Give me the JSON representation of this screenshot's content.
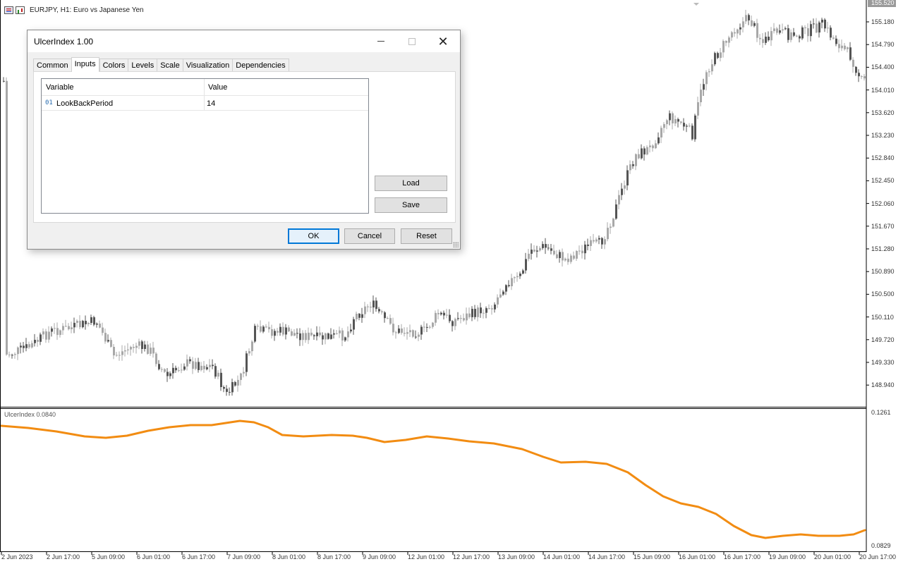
{
  "chart": {
    "symbol_title": "EURJPY, H1:  Euro vs Japanese Yen",
    "current_price": "155.520",
    "price_axis": [
      "155.180",
      "154.790",
      "154.400",
      "154.010",
      "153.620",
      "153.230",
      "152.840",
      "152.450",
      "152.060",
      "151.670",
      "151.280",
      "150.890",
      "150.500",
      "150.110",
      "149.720",
      "149.330",
      "148.940"
    ],
    "time_axis": [
      "2 Jun 2023",
      "2 Jun 17:00",
      "5 Jun 09:00",
      "6 Jun 01:00",
      "6 Jun 17:00",
      "7 Jun 09:00",
      "8 Jun 01:00",
      "8 Jun 17:00",
      "9 Jun 09:00",
      "12 Jun 01:00",
      "12 Jun 17:00",
      "13 Jun 09:00",
      "14 Jun 01:00",
      "14 Jun 17:00",
      "15 Jun 09:00",
      "16 Jun 01:00",
      "16 Jun 17:00",
      "19 Jun 09:00",
      "20 Jun 01:00",
      "20 Jun 17:00"
    ],
    "indicator_label": "UlcerIndex 0.0840",
    "indicator_axis_top": "0.1261",
    "indicator_axis_bottom": "0.0829",
    "colors": {
      "candle": "#a8a8a8",
      "candle_dark": "#555555",
      "indicator_line": "#f28c12",
      "axis_line": "#000000"
    },
    "icons": [
      "chart-window-icon",
      "chart-type-icon"
    ]
  },
  "dialog": {
    "title": "UlcerIndex 1.00",
    "tabs": [
      "Common",
      "Inputs",
      "Colors",
      "Levels",
      "Scale",
      "Visualization",
      "Dependencies"
    ],
    "active_tab": "Inputs",
    "grid": {
      "col_variable": "Variable",
      "col_value": "Value",
      "rows": [
        {
          "icon": "01",
          "variable": "LookBackPeriod",
          "value": "14"
        }
      ]
    },
    "buttons": {
      "load": "Load",
      "save": "Save",
      "ok": "OK",
      "cancel": "Cancel",
      "reset": "Reset"
    },
    "window_controls": {
      "close": "✕"
    }
  }
}
